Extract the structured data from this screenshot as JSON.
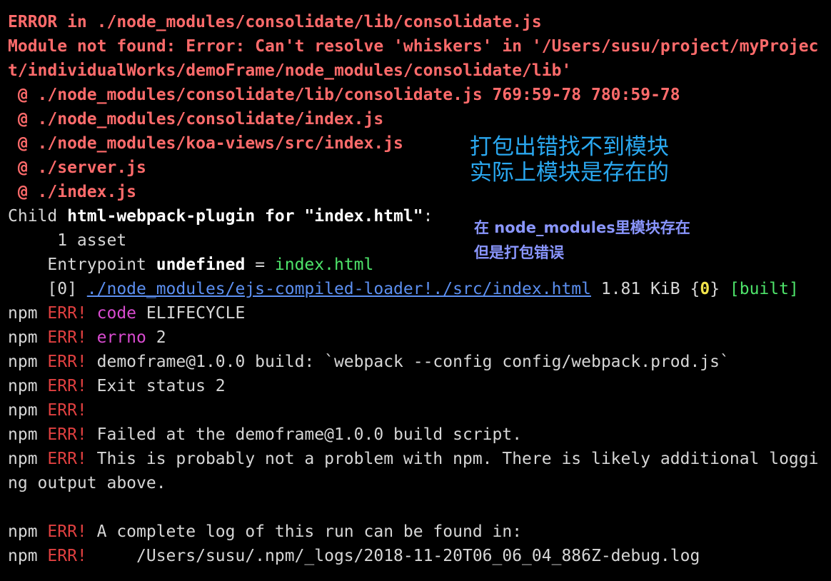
{
  "terminal": {
    "lines": [
      [
        {
          "t": "ERROR in ./node_modules/consolidate/lib/consolidate.js",
          "c": "red bold"
        }
      ],
      [
        {
          "t": "Module not found: Error: Can't resolve 'whiskers' in '/Users/susu/project/myProjec",
          "c": "red bold"
        }
      ],
      [
        {
          "t": "t/individualWorks/demoFrame/node_modules/consolidate/lib'",
          "c": "red bold"
        }
      ],
      [
        {
          "t": " @ ./node_modules/consolidate/lib/consolidate.js 769:59-78 780:59-78",
          "c": "red bold"
        }
      ],
      [
        {
          "t": " @ ./node_modules/consolidate/index.js",
          "c": "red bold"
        }
      ],
      [
        {
          "t": " @ ./node_modules/koa-views/src/index.js",
          "c": "red bold"
        }
      ],
      [
        {
          "t": " @ ./server.js",
          "c": "red bold"
        }
      ],
      [
        {
          "t": " @ ./index.js",
          "c": "red bold"
        }
      ],
      [
        {
          "t": "Child ",
          "c": "white"
        },
        {
          "t": "html-webpack-plugin for \"index.html\"",
          "c": "bright"
        },
        {
          "t": ":",
          "c": "white"
        }
      ],
      [
        {
          "t": "     1 asset",
          "c": "white"
        }
      ],
      [
        {
          "t": "    Entrypoint ",
          "c": "white"
        },
        {
          "t": "undefined",
          "c": "bright"
        },
        {
          "t": " = ",
          "c": "white"
        },
        {
          "t": "index.html",
          "c": "green"
        }
      ],
      [
        {
          "t": "    [0] ",
          "c": "white"
        },
        {
          "t": "./node_modules/ejs-compiled-loader!./src/index.html",
          "c": "link"
        },
        {
          "t": " 1.81 KiB {",
          "c": "white"
        },
        {
          "t": "0",
          "c": "yellow"
        },
        {
          "t": "} ",
          "c": "white"
        },
        {
          "t": "[built]",
          "c": "green"
        }
      ],
      [
        {
          "t": "npm ",
          "c": "white"
        },
        {
          "t": "ERR!",
          "c": "darkred"
        },
        {
          "t": " ",
          "c": "white"
        },
        {
          "t": "code",
          "c": "magenta"
        },
        {
          "t": " ELIFECYCLE",
          "c": "white"
        }
      ],
      [
        {
          "t": "npm ",
          "c": "white"
        },
        {
          "t": "ERR!",
          "c": "darkred"
        },
        {
          "t": " ",
          "c": "white"
        },
        {
          "t": "errno",
          "c": "magenta"
        },
        {
          "t": " 2",
          "c": "white"
        }
      ],
      [
        {
          "t": "npm ",
          "c": "white"
        },
        {
          "t": "ERR!",
          "c": "darkred"
        },
        {
          "t": " demoframe@1.0.0 build: `webpack --config config/webpack.prod.js`",
          "c": "white"
        }
      ],
      [
        {
          "t": "npm ",
          "c": "white"
        },
        {
          "t": "ERR!",
          "c": "darkred"
        },
        {
          "t": " Exit status 2",
          "c": "white"
        }
      ],
      [
        {
          "t": "npm ",
          "c": "white"
        },
        {
          "t": "ERR!",
          "c": "darkred"
        }
      ],
      [
        {
          "t": "npm ",
          "c": "white"
        },
        {
          "t": "ERR!",
          "c": "darkred"
        },
        {
          "t": " Failed at the demoframe@1.0.0 build script.",
          "c": "white"
        }
      ],
      [
        {
          "t": "npm ",
          "c": "white"
        },
        {
          "t": "ERR!",
          "c": "darkred"
        },
        {
          "t": " This is probably not a problem with npm. There is likely additional loggi",
          "c": "white"
        }
      ],
      [
        {
          "t": "ng output above.",
          "c": "white"
        }
      ],
      [],
      [
        {
          "t": "npm ",
          "c": "white"
        },
        {
          "t": "ERR!",
          "c": "darkred"
        },
        {
          "t": " A complete log of this run can be found in:",
          "c": "white"
        }
      ],
      [
        {
          "t": "npm ",
          "c": "white"
        },
        {
          "t": "ERR!",
          "c": "darkred"
        },
        {
          "t": "     /Users/susu/.npm/_logs/2018-11-20T06_06_04_886Z-debug.log",
          "c": "white"
        }
      ]
    ]
  },
  "annotations": {
    "primary_line1": "打包出错找不到模块",
    "primary_line2": "实际上模块是存在的",
    "secondary_line1": "在 node_modules里模块存在",
    "secondary_line2": "但是打包错误"
  },
  "colors": {
    "background": "#000000",
    "error_text": "#ff6b6b",
    "npm_err": "#e04040",
    "keyword": "#d94bd0",
    "success": "#4ee36a",
    "chunk_id": "#f2e44b",
    "link": "#5c8ff0",
    "annotation_primary": "#2aa8f0",
    "annotation_secondary": "#8a96ff"
  }
}
